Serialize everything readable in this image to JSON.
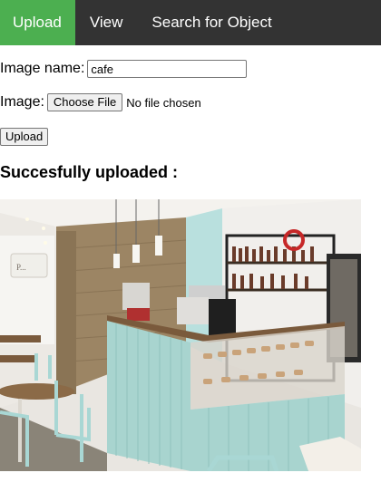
{
  "nav": {
    "items": [
      {
        "label": "Upload",
        "active": true
      },
      {
        "label": "View",
        "active": false
      },
      {
        "label": "Search for Object",
        "active": false
      }
    ],
    "active_color": "#4caf50",
    "bar_color": "#333333"
  },
  "form": {
    "image_name_label": "Image name:",
    "image_name_value": "cafe",
    "image_label": "Image:",
    "choose_file_label": "Choose File",
    "file_status": "No file chosen",
    "upload_label": "Upload"
  },
  "result": {
    "message": "Succesfully uploaded :"
  }
}
